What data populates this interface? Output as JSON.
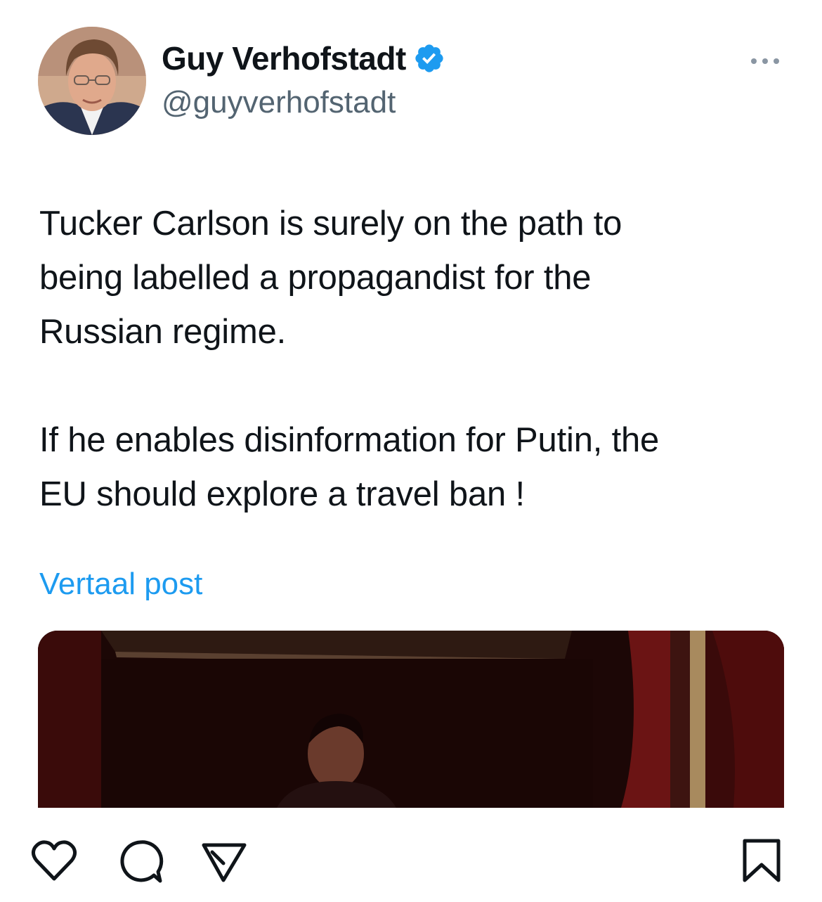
{
  "header": {
    "display_name": "Guy Verhofstadt",
    "handle": "@guyverhofstadt",
    "avatar_icon": "profile-photo",
    "verified_icon": "verified-badge-icon",
    "more_icon": "more-options-icon"
  },
  "tweet": {
    "paragraphs": [
      "Tucker Carlson is surely on the path to\nbeing labelled a propagandist for the\nRussian regime.",
      "If he enables disinformation for Putin, the\nEU should explore a travel ban !"
    ],
    "translate_label": "Vertaal post"
  },
  "media": {
    "icon": "embedded-photo"
  },
  "actions": {
    "like_icon": "heart-icon",
    "comment_icon": "comment-icon",
    "share_icon": "send-icon",
    "save_icon": "bookmark-icon"
  },
  "colors": {
    "text": "#0f1419",
    "secondary": "#536471",
    "link": "#1d9bf0",
    "verified": "#1d9bf0"
  }
}
